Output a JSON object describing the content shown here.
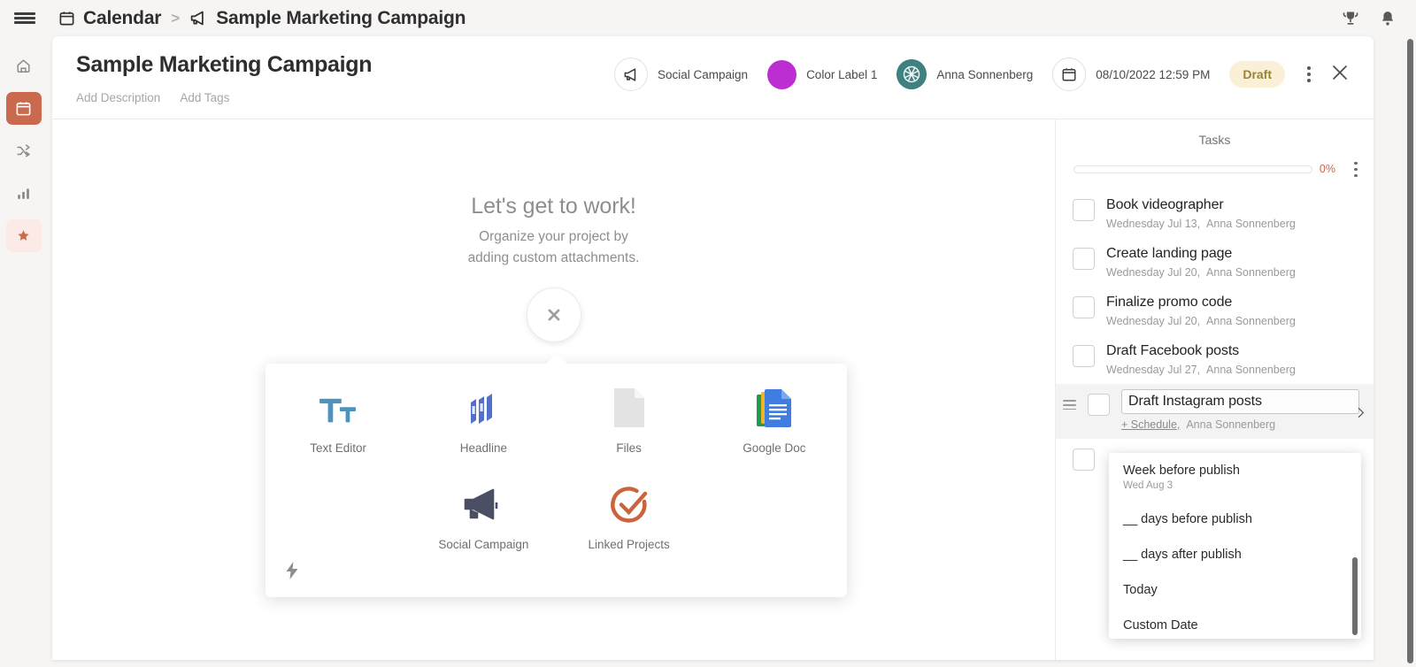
{
  "topbar": {
    "menu_label": "menu",
    "breadcrumb": [
      {
        "icon": "calendar-icon",
        "label": "Calendar"
      },
      {
        "icon": "megaphone-icon",
        "label": "Sample Marketing Campaign"
      }
    ],
    "separator": ">",
    "right_icons": [
      {
        "name": "trophy-icon",
        "label": "Achievements"
      },
      {
        "name": "bell-icon",
        "label": "Notifications"
      }
    ]
  },
  "rail": {
    "items": [
      {
        "name": "home-icon",
        "label": "Home",
        "state": "default"
      },
      {
        "name": "calendar-icon",
        "label": "Calendar",
        "state": "active"
      },
      {
        "name": "shuffle-icon",
        "label": "Workflows",
        "state": "default"
      },
      {
        "name": "chart-icon",
        "label": "Analytics",
        "state": "default"
      },
      {
        "name": "star-icon",
        "label": "Favorites",
        "state": "soft"
      }
    ]
  },
  "header": {
    "title": "Sample Marketing Campaign",
    "add_description": "Add Description",
    "add_tags": "Add Tags",
    "campaign_type": "Social Campaign",
    "color_label": "Color Label 1",
    "color_label_hex": "#bc2ed1",
    "owner": "Anna Sonnenberg",
    "datetime": "08/10/2022 12:59 PM",
    "status": "Draft",
    "status_bg_hex": "#faf0d7",
    "status_text_hex": "#9c8336",
    "more_label": "More options",
    "close_label": "Close"
  },
  "empty_state": {
    "heading": "Let's get to work!",
    "line1": "Organize your project by",
    "line2": "adding custom attachments.",
    "toggle_icon": "close-icon"
  },
  "picker": {
    "items": [
      {
        "label": "Text Editor",
        "icon": "text-editor-icon"
      },
      {
        "label": "Headline",
        "icon": "headline-icon"
      },
      {
        "label": "Files",
        "icon": "file-icon"
      },
      {
        "label": "Google Doc",
        "icon": "google-doc-icon"
      },
      {
        "label": "Social Campaign",
        "icon": "megaphone-icon"
      },
      {
        "label": "Linked Projects",
        "icon": "check-circle-icon"
      }
    ],
    "bolt_icon": "lightning-bolt-icon"
  },
  "tasks": {
    "title": "Tasks",
    "progress_percent": "0%",
    "progress_value": 0,
    "menu_label": "Task options",
    "items": [
      {
        "name": "Book videographer",
        "date": "Wednesday Jul 13,",
        "assignee": "Anna Sonnenberg",
        "checked": false,
        "editing": false
      },
      {
        "name": "Create landing page",
        "date": "Wednesday Jul 20,",
        "assignee": "Anna Sonnenberg",
        "checked": false,
        "editing": false
      },
      {
        "name": "Finalize promo code",
        "date": "Wednesday Jul 20,",
        "assignee": "Anna Sonnenberg",
        "checked": false,
        "editing": false
      },
      {
        "name": "Draft Facebook posts",
        "date": "Wednesday Jul 27,",
        "assignee": "Anna Sonnenberg",
        "checked": false,
        "editing": false
      },
      {
        "name": "Draft Instagram posts",
        "date": "+ Schedule,",
        "assignee": "Anna Sonnenberg",
        "checked": false,
        "editing": true
      }
    ]
  },
  "schedule_dropdown": {
    "options": [
      {
        "label": "Week before publish",
        "sub": "Wed Aug 3"
      },
      {
        "label": "__ days before publish",
        "sub": ""
      },
      {
        "label": "__ days after publish",
        "sub": ""
      },
      {
        "label": "Today",
        "sub": ""
      },
      {
        "label": "Custom Date",
        "sub": ""
      }
    ]
  }
}
